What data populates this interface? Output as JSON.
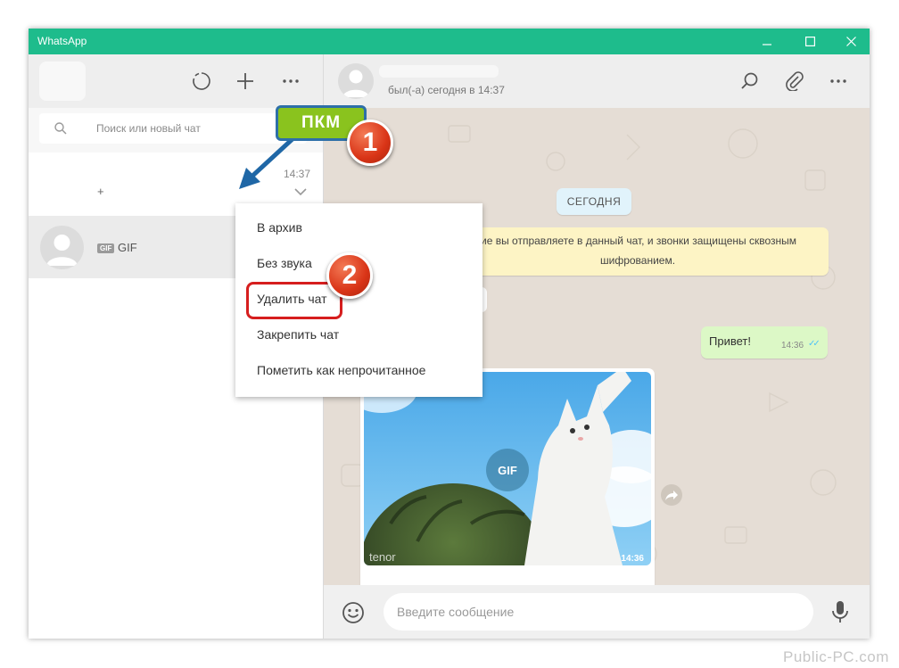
{
  "window": {
    "title": "WhatsApp",
    "controls": {
      "minimize": "—",
      "maximize": "☐",
      "close": "✕"
    }
  },
  "sidebar": {
    "icons": [
      "status-icon",
      "new-chat-icon",
      "menu-icon"
    ],
    "search": {
      "placeholder": "Поиск или новый чат"
    },
    "chats": [
      {
        "time": "14:37",
        "preview": "+"
      },
      {
        "badge": "GIF",
        "preview": "GIF"
      }
    ]
  },
  "chat": {
    "status": "был(-а) сегодня в 14:37",
    "date_chip": "СЕГОДНЯ",
    "encryption_line1": "ие вы отправляете в данный чат, и звонки защищены сквозным",
    "encryption_line2": "шифрованием.",
    "outgoing": {
      "text": "Привет!",
      "time": "14:36",
      "ticks": "✓✓"
    },
    "gif": {
      "badge": "GIF",
      "watermark": "tenor",
      "time": "14:36"
    },
    "compose_placeholder": "Введите сообщение"
  },
  "context_menu": {
    "items": [
      "В архив",
      "Без звука",
      "Удалить чат",
      "Закрепить чат",
      "Пометить как непрочитанное"
    ]
  },
  "annotations": {
    "label": "ПКМ",
    "step1": "1",
    "step2": "2"
  },
  "footer_watermark": "Public-PC.com",
  "colors": {
    "titlebar": "#1ebc8c",
    "chat_bg": "#e5ddd5",
    "outgoing_bubble": "#dcf8c6",
    "date_chip": "#e1f3fb",
    "encryption_note": "#fdf4c5",
    "annotation_label": "#8ac31e",
    "annotation_step": "#d93417"
  }
}
